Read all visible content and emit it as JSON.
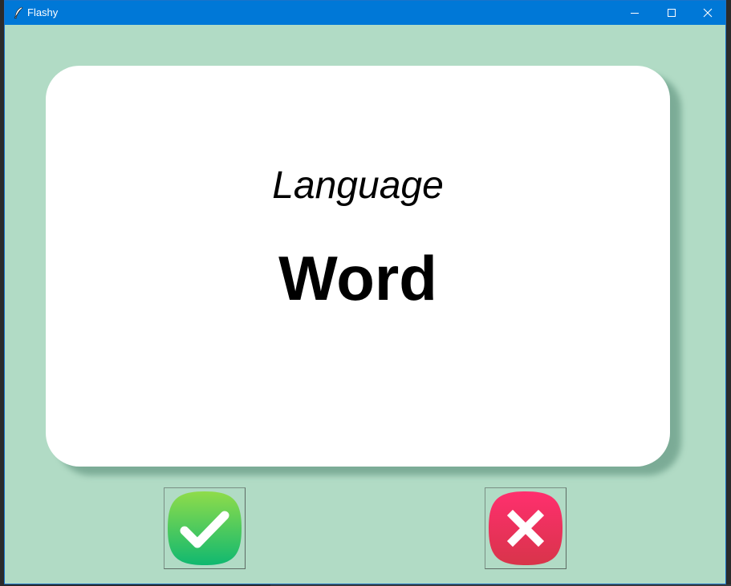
{
  "window": {
    "title": "Flashy",
    "icon": "feather-icon",
    "controls": {
      "minimize_icon": "minimize-icon",
      "maximize_icon": "maximize-icon",
      "close_icon": "close-icon"
    }
  },
  "card": {
    "language": "Language",
    "word": "Word"
  },
  "buttons": {
    "right_icon": "checkmark-icon",
    "wrong_icon": "cross-icon"
  },
  "colors": {
    "titlebar": "#0078d7",
    "background": "#b1dbc5",
    "card": "#ffffff",
    "right_button": "#2dbe5a",
    "wrong_button": "#e3315a"
  }
}
